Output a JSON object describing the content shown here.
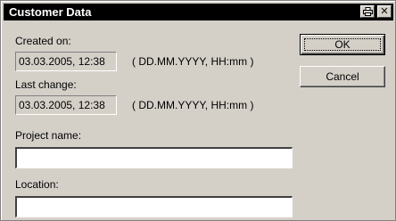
{
  "window": {
    "title": "Customer Data",
    "print_icon": "print-icon",
    "close_glyph": "✕"
  },
  "created": {
    "label": "Created on:",
    "value": "03.03.2005, 12:38",
    "format": "( DD.MM.YYYY, HH:mm )"
  },
  "last_change": {
    "label": "Last change:",
    "value": "03.03.2005, 12:38",
    "format": "( DD.MM.YYYY, HH:mm )"
  },
  "project": {
    "label": "Project name:",
    "value": "",
    "placeholder": ""
  },
  "location": {
    "label": "Location:",
    "value": "",
    "placeholder": ""
  },
  "buttons": {
    "ok": "OK",
    "cancel": "Cancel"
  },
  "colors": {
    "dialog_face": "#d4d0c8",
    "titlebar": "#000000",
    "title_text": "#ffffff"
  }
}
